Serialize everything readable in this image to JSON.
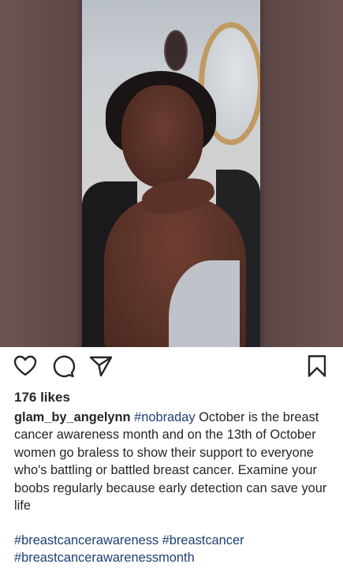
{
  "post": {
    "image_alt": "Selfie of a woman resting her chin on her hand",
    "likes": "176 likes",
    "username": "glam_by_angelynn",
    "inline_hashtag": "#nobraday",
    "caption": "October is the breast cancer awareness month and on the 13th of October women go braless to show their support to everyone who's battling or battled breast cancer. Examine your boobs regularly because early detection can save your life",
    "hashtags_line1": "#breastcancerawareness #breastcancer",
    "hashtags_line2": "#breastcancerawarenessmonth"
  },
  "icons": {
    "like": "heart-icon",
    "comment": "comment-bubble-icon",
    "share": "paper-plane-icon",
    "save": "bookmark-icon"
  },
  "colors": {
    "text": "#262626",
    "hashtag": "#1d3f73",
    "background": "#ffffff"
  }
}
